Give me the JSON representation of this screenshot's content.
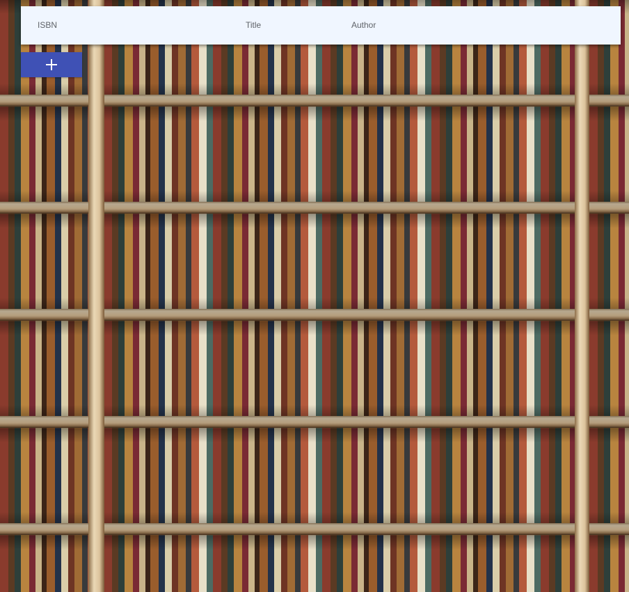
{
  "table": {
    "columns": {
      "isbn": "ISBN",
      "title": "Title",
      "author": "Author"
    }
  },
  "toolbar": {
    "add_button": {
      "icon": "plus-icon",
      "color": "#3f51b5"
    }
  },
  "theme": {
    "header_background": "#f0f6ff",
    "header_text": "#5f6368"
  }
}
